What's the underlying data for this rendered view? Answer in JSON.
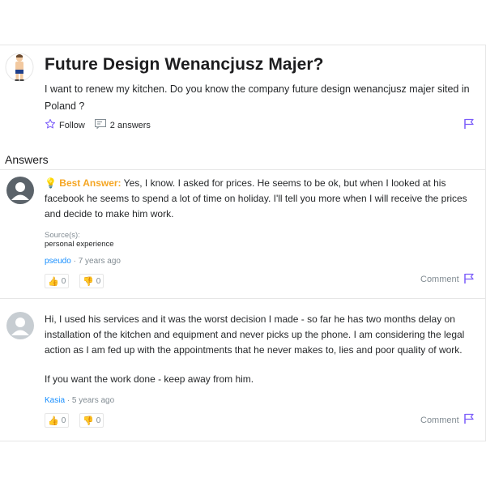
{
  "question": {
    "title": "Future Design Wenancjusz Majer?",
    "body": "I want to renew my kitchen. Do you know the company future design wenancjusz majer sited in Poland ?",
    "follow_label": "Follow",
    "answers_count": "2 answers"
  },
  "answers_heading": "Answers",
  "answers": [
    {
      "best_label": "Best Answer:",
      "text": "Yes, I know. I asked for prices. He seems to be ok, but when I looked at his facebook he seems to spend a lot of time on holiday. I'll tell you more when I will receive the prices and decide to make him work.",
      "source_label": "Source(s):",
      "source_value": "personal experience",
      "user": "pseudo",
      "time": "· 7 years ago",
      "upvotes": "0",
      "downvotes": "0",
      "comment_label": "Comment"
    },
    {
      "text": "Hi, I used his services and it was the worst decision I made - so far he has two months delay on installation of the kitchen and equipment and never picks up the phone. I am considering the legal action as I am fed up with the appointments that he never makes to, lies and poor quality of work.",
      "text2": "If you want the work done - keep away from him.",
      "user": "Kasia",
      "time": "· 5 years ago",
      "upvotes": "0",
      "downvotes": "0",
      "comment_label": "Comment"
    }
  ],
  "colors": {
    "accent": "#188fff",
    "best": "#f5a623",
    "flag": "#7b5cfa"
  },
  "icons": [
    "star-outline-icon",
    "speech-bubble-icon",
    "flag-icon",
    "thumbs-up-icon",
    "thumbs-down-icon",
    "user-silhouette-icon"
  ]
}
